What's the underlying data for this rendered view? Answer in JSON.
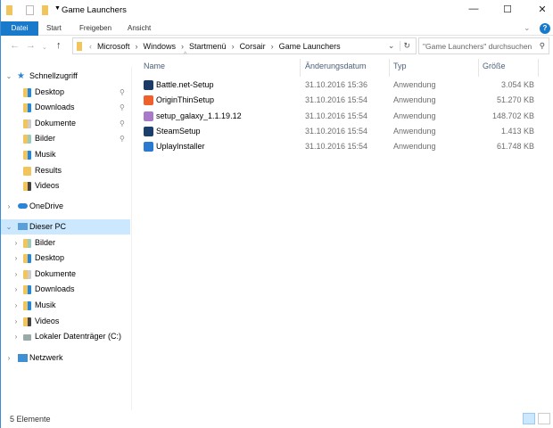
{
  "window": {
    "title": "Game Launchers",
    "minimize": "—",
    "maximize": "☐",
    "close": "✕"
  },
  "ribbon": {
    "tabs": [
      "Datei",
      "Start",
      "Freigeben",
      "Ansicht"
    ],
    "help": "?"
  },
  "address": {
    "path": [
      "Microsoft",
      "Windows",
      "Startmenü",
      "Corsair",
      "Game Launchers"
    ],
    "search_placeholder": "\"Game Launchers\" durchsuchen"
  },
  "columns": [
    "Name",
    "Änderungsdatum",
    "Typ",
    "Größe"
  ],
  "files": [
    {
      "name": "Battle.net-Setup",
      "date": "31.10.2016 15:36",
      "type": "Anwendung",
      "size": "3.054 KB",
      "color": "#1b3a66"
    },
    {
      "name": "OriginThinSetup",
      "date": "31.10.2016 15:54",
      "type": "Anwendung",
      "size": "51.270 KB",
      "color": "#f0602a"
    },
    {
      "name": "setup_galaxy_1.1.19.12",
      "date": "31.10.2016 15:54",
      "type": "Anwendung",
      "size": "148.702 KB",
      "color": "#a77bc9"
    },
    {
      "name": "SteamSetup",
      "date": "31.10.2016 15:54",
      "type": "Anwendung",
      "size": "1.413 KB",
      "color": "#1d3f6e"
    },
    {
      "name": "UplayInstaller",
      "date": "31.10.2016 15:54",
      "type": "Anwendung",
      "size": "61.748 KB",
      "color": "#2a7ad1"
    }
  ],
  "sidebar": {
    "quick_access": "Schnellzugriff",
    "quick_items": [
      "Desktop",
      "Downloads",
      "Dokumente",
      "Bilder",
      "Musik",
      "Results",
      "Videos"
    ],
    "onedrive": "OneDrive",
    "this_pc": "Dieser PC",
    "pc_items": [
      "Bilder",
      "Desktop",
      "Dokumente",
      "Downloads",
      "Musik",
      "Videos",
      "Lokaler Datenträger (C:)"
    ],
    "network": "Netzwerk"
  },
  "status": {
    "count": "5 Elemente"
  }
}
